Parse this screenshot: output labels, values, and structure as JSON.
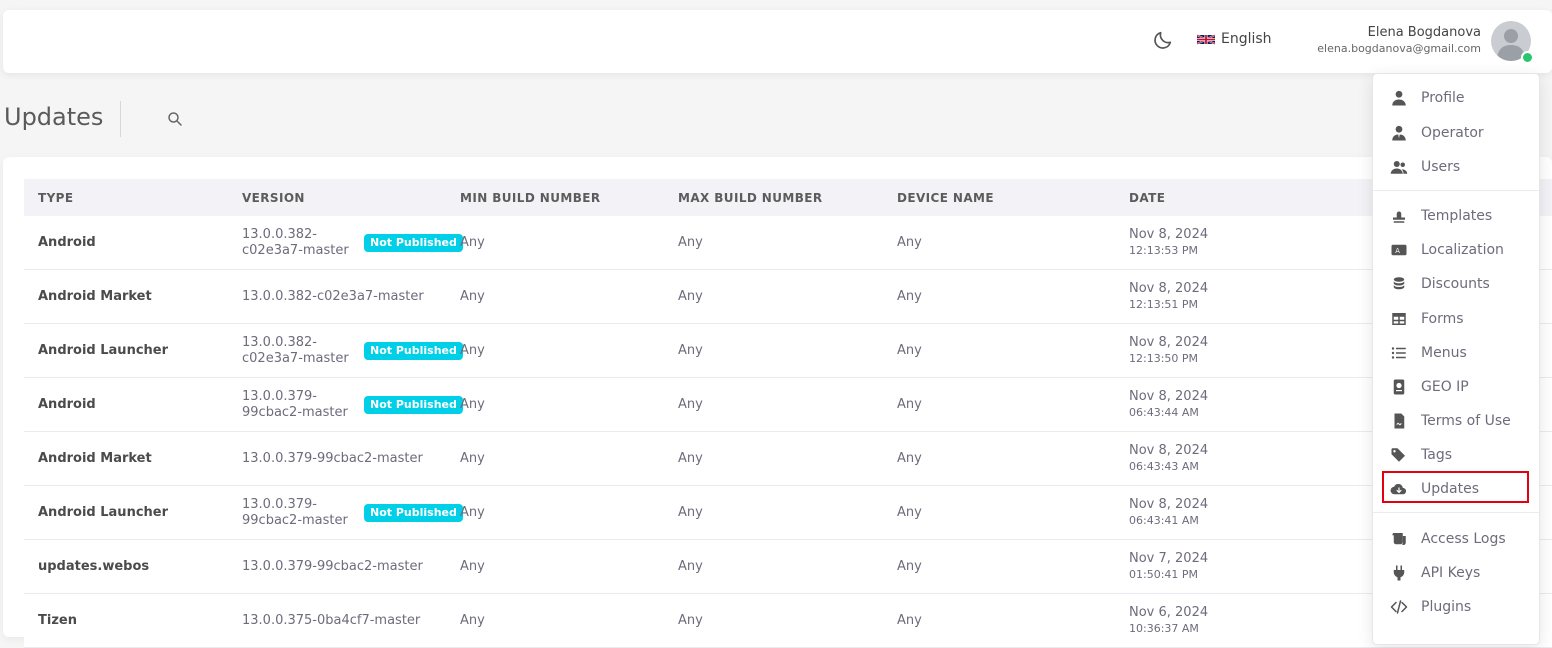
{
  "header": {
    "theme_toggle_icon": "moon-icon",
    "language": {
      "flag_icon": "uk-flag-icon",
      "label": "English"
    },
    "user": {
      "name": "Elena Bogdanova",
      "email": "elena.bogdanova@gmail.com",
      "status_color": "#28c76f"
    }
  },
  "page": {
    "title": "Updates",
    "search_icon": "search-icon"
  },
  "table": {
    "headers": [
      "TYPE",
      "VERSION",
      "MIN BUILD NUMBER",
      "MAX BUILD NUMBER",
      "DEVICE NAME",
      "DATE"
    ],
    "rows": [
      {
        "type": "Android",
        "version": "13.0.0.382-c02e3a7-master",
        "badge": "Not Published",
        "min": "Any",
        "max": "Any",
        "device": "Any",
        "date": "Nov 8, 2024",
        "time": "12:13:53 PM"
      },
      {
        "type": "Android Market",
        "version": "13.0.0.382-c02e3a7-master",
        "badge": "",
        "min": "Any",
        "max": "Any",
        "device": "Any",
        "date": "Nov 8, 2024",
        "time": "12:13:51 PM"
      },
      {
        "type": "Android Launcher",
        "version": "13.0.0.382-c02e3a7-master",
        "badge": "Not Published",
        "min": "Any",
        "max": "Any",
        "device": "Any",
        "date": "Nov 8, 2024",
        "time": "12:13:50 PM"
      },
      {
        "type": "Android",
        "version": "13.0.0.379-99cbac2-master",
        "badge": "Not Published",
        "min": "Any",
        "max": "Any",
        "device": "Any",
        "date": "Nov 8, 2024",
        "time": "06:43:44 AM"
      },
      {
        "type": "Android Market",
        "version": "13.0.0.379-99cbac2-master",
        "badge": "",
        "min": "Any",
        "max": "Any",
        "device": "Any",
        "date": "Nov 8, 2024",
        "time": "06:43:43 AM"
      },
      {
        "type": "Android Launcher",
        "version": "13.0.0.379-99cbac2-master",
        "badge": "Not Published",
        "min": "Any",
        "max": "Any",
        "device": "Any",
        "date": "Nov 8, 2024",
        "time": "06:43:41 AM"
      },
      {
        "type": "updates.webos",
        "version": "13.0.0.379-99cbac2-master",
        "badge": "",
        "min": "Any",
        "max": "Any",
        "device": "Any",
        "date": "Nov 7, 2024",
        "time": "01:50:41 PM"
      },
      {
        "type": "Tizen",
        "version": "13.0.0.375-0ba4cf7-master",
        "badge": "",
        "min": "Any",
        "max": "Any",
        "device": "Any",
        "date": "Nov 6, 2024",
        "time": "10:36:37 AM"
      }
    ]
  },
  "menu": {
    "groups": [
      [
        {
          "label": "Profile",
          "icon": "user-icon"
        },
        {
          "label": "Operator",
          "icon": "user-tie-icon"
        },
        {
          "label": "Users",
          "icon": "users-icon"
        }
      ],
      [
        {
          "label": "Templates",
          "icon": "stamp-icon"
        },
        {
          "label": "Localization",
          "icon": "language-card-icon"
        },
        {
          "label": "Discounts",
          "icon": "coins-icon"
        },
        {
          "label": "Forms",
          "icon": "table-icon"
        },
        {
          "label": "Menus",
          "icon": "list-icon"
        },
        {
          "label": "GEO IP",
          "icon": "passport-icon"
        },
        {
          "label": "Terms of Use",
          "icon": "file-signature-icon"
        },
        {
          "label": "Tags",
          "icon": "tags-icon"
        },
        {
          "label": "Updates",
          "icon": "cloud-download-icon",
          "active": true
        }
      ],
      [
        {
          "label": "Access Logs",
          "icon": "scroll-icon"
        },
        {
          "label": "API Keys",
          "icon": "plug-icon"
        },
        {
          "label": "Plugins",
          "icon": "code-icon"
        }
      ]
    ],
    "highlight_color": "#e3000f"
  },
  "colors": {
    "badge": "#00cfe8",
    "accent_highlight": "#e3000f"
  }
}
